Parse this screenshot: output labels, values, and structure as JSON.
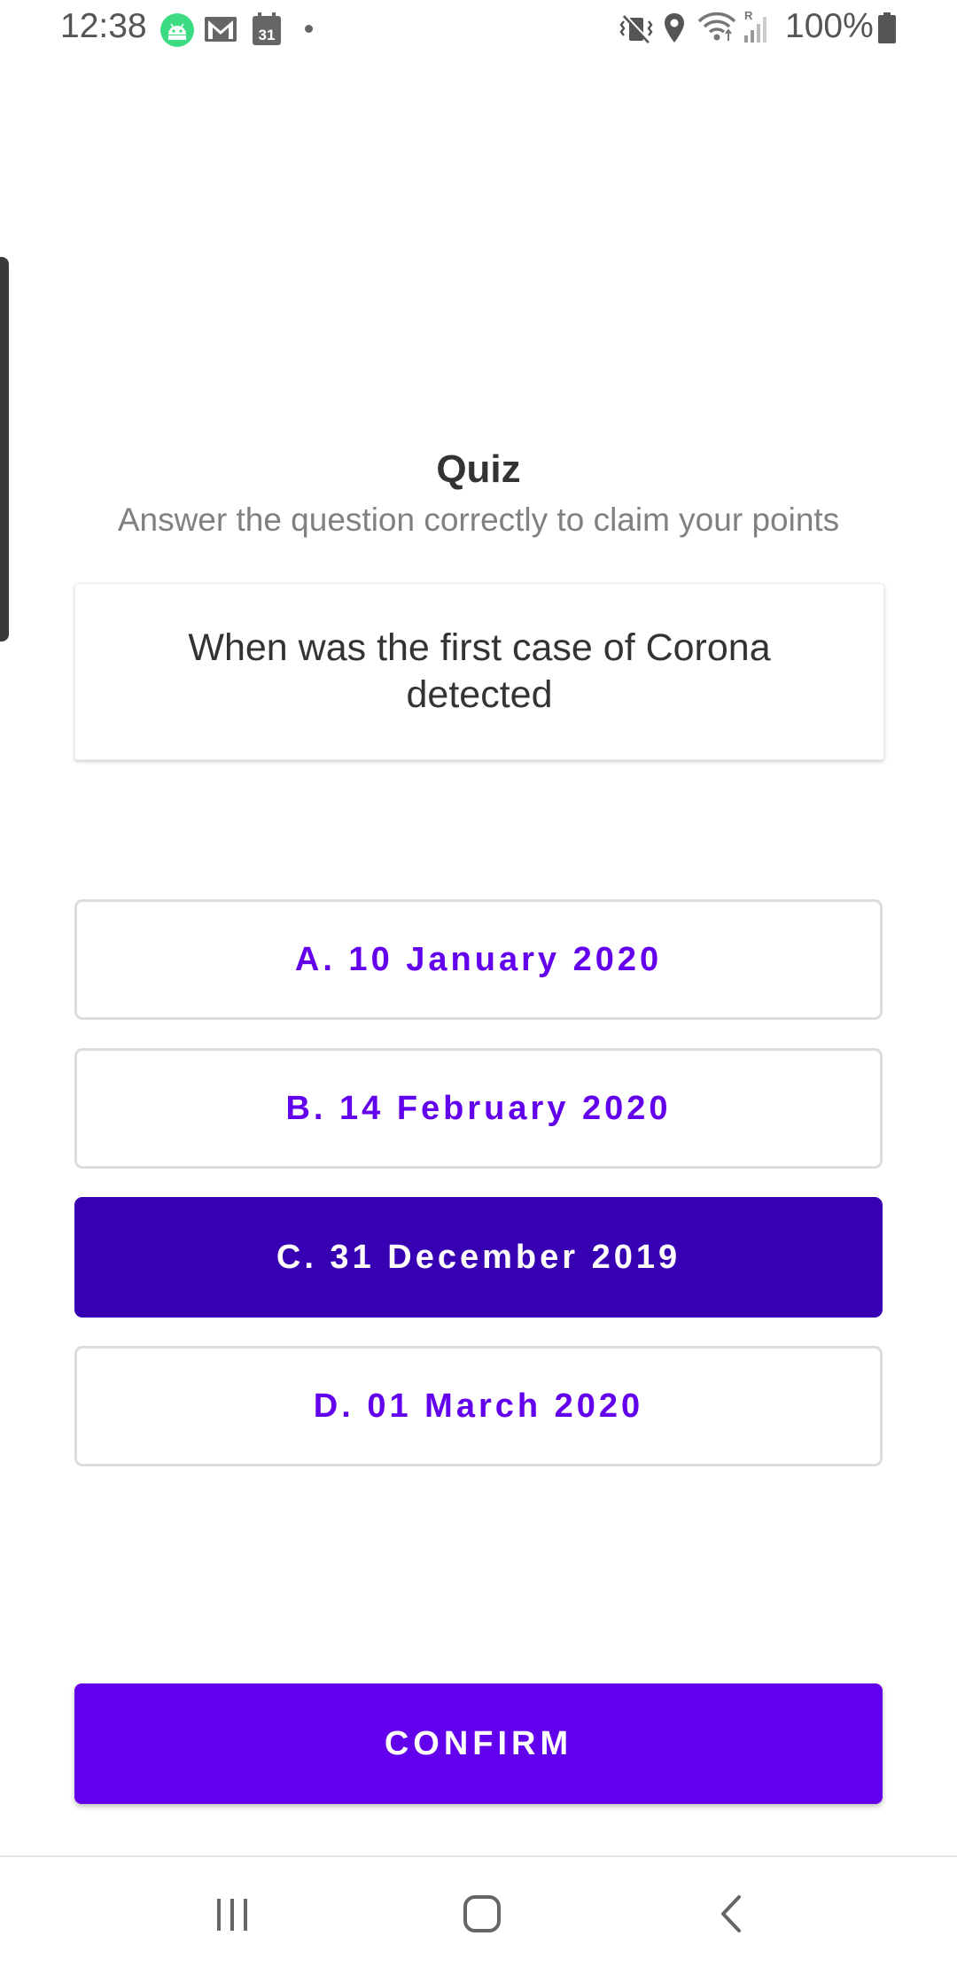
{
  "status_bar": {
    "time": "12:38",
    "battery_text": "100%",
    "left_icons": [
      "android-icon",
      "gmail-icon",
      "calendar-icon"
    ],
    "calendar_day": "31",
    "right_icons": [
      "vibrate-mute-icon",
      "location-icon",
      "wifi-icon",
      "signal-icon",
      "battery-icon"
    ],
    "signal_roaming_label": "R",
    "android_icon_color": "#3ddc84"
  },
  "quiz": {
    "title": "Quiz",
    "subtitle": "Answer the question correctly to claim your points",
    "question": "When was the first case of Corona detected",
    "options": [
      {
        "label": "A. 10 January 2020",
        "selected": false
      },
      {
        "label": "B. 14 February 2020",
        "selected": false
      },
      {
        "label": "C. 31 December 2019",
        "selected": true
      },
      {
        "label": "D. 01 March 2020",
        "selected": false
      }
    ],
    "confirm_label": "CONFIRM"
  },
  "colors": {
    "accent": "#6200ee",
    "selected": "#3700b3",
    "option_border": "#dcdcdc"
  },
  "nav_bar": {
    "buttons": [
      "recent-apps-icon",
      "home-icon",
      "back-icon"
    ]
  }
}
